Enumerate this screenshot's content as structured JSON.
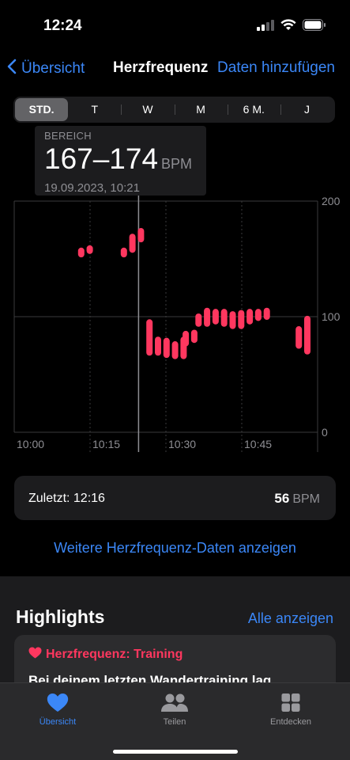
{
  "status": {
    "time": "12:24"
  },
  "nav": {
    "back_label": "Übersicht",
    "title": "Herzfrequenz",
    "add_label": "Daten hinzufügen"
  },
  "segments": [
    {
      "label": "STD.",
      "active": true
    },
    {
      "label": "T"
    },
    {
      "label": "W"
    },
    {
      "label": "M"
    },
    {
      "label": "6 M."
    },
    {
      "label": "J"
    }
  ],
  "tooltip": {
    "label": "BEREICH",
    "value": "167–174",
    "unit": "BPM",
    "date": "19.09.2023, 10:21"
  },
  "chart_data": {
    "type": "range-bar",
    "xlabels": [
      "10:00",
      "10:15",
      "10:30",
      "10:45"
    ],
    "ylabels": [
      "200",
      "100",
      "0"
    ],
    "ylim": [
      0,
      200
    ],
    "x_range_minutes": [
      0,
      60
    ],
    "selected_minute": 21,
    "color": "#ff375f",
    "points": [
      {
        "t": 7,
        "min": 154,
        "max": 157
      },
      {
        "t": 9,
        "min": 157,
        "max": 159
      },
      {
        "t": 17,
        "min": 154,
        "max": 157
      },
      {
        "t": 19,
        "min": 158,
        "max": 169
      },
      {
        "t": 21,
        "min": 167,
        "max": 174
      },
      {
        "t": 23,
        "min": 69,
        "max": 95
      },
      {
        "t": 25,
        "min": 69,
        "max": 80
      },
      {
        "t": 27,
        "min": 67,
        "max": 79
      },
      {
        "t": 29,
        "min": 66,
        "max": 76
      },
      {
        "t": 31,
        "min": 66,
        "max": 80
      },
      {
        "t": 31.5,
        "min": 77,
        "max": 85
      },
      {
        "t": 33.5,
        "min": 80,
        "max": 86
      },
      {
        "t": 34.5,
        "min": 94,
        "max": 100
      },
      {
        "t": 36.5,
        "min": 94,
        "max": 105
      },
      {
        "t": 38.5,
        "min": 96,
        "max": 104
      },
      {
        "t": 40.5,
        "min": 94,
        "max": 104
      },
      {
        "t": 42.5,
        "min": 92,
        "max": 102
      },
      {
        "t": 44.5,
        "min": 92,
        "max": 103
      },
      {
        "t": 46.5,
        "min": 96,
        "max": 104
      },
      {
        "t": 48.5,
        "min": 99,
        "max": 104
      },
      {
        "t": 50.5,
        "min": 100,
        "max": 105
      },
      {
        "t": 58,
        "min": 75,
        "max": 89
      },
      {
        "t": 60,
        "min": 70,
        "max": 98
      }
    ]
  },
  "latest": {
    "label": "Zuletzt: 12:16",
    "value": "56",
    "unit": "BPM"
  },
  "more_link": "Weitere Herzfrequenz-Daten anzeigen",
  "highlights": {
    "title": "Highlights",
    "all_label": "Alle anzeigen",
    "card": {
      "heading": "Herzfrequenz: Training",
      "text": "Bei deinem letzten Wandertraining lag"
    }
  },
  "tabs": [
    {
      "label": "Übersicht",
      "icon": "heart-icon",
      "active": true
    },
    {
      "label": "Teilen",
      "icon": "people-icon"
    },
    {
      "label": "Entdecken",
      "icon": "grid-icon"
    }
  ]
}
